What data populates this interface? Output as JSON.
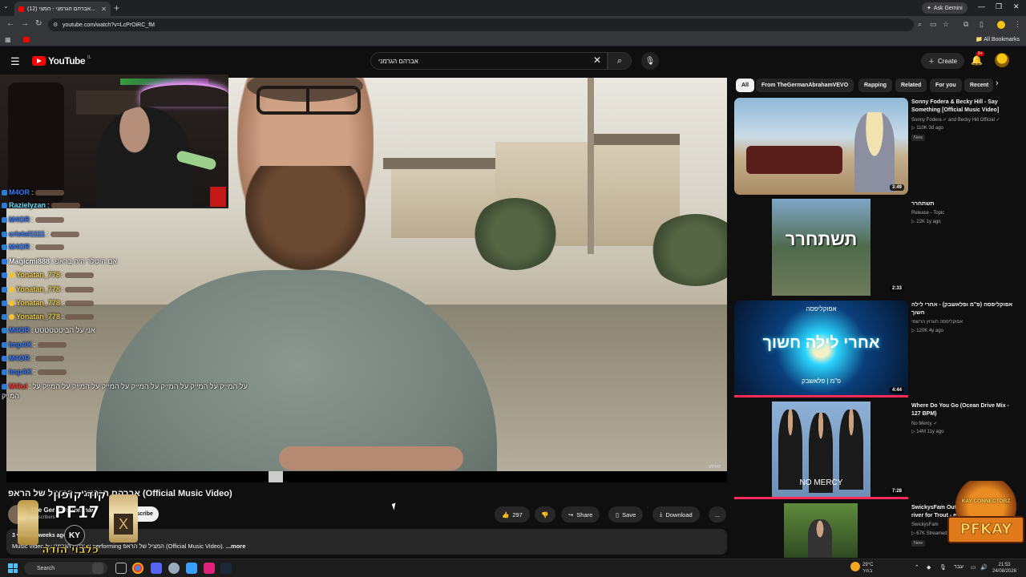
{
  "browser": {
    "tab_title": "(12) אברהם הגרמני - המצי...",
    "url": "youtube.com/watch?v=LcPrOiRC_fM",
    "ask_gemini": "Ask Gemini",
    "all_bookmarks": "All Bookmarks"
  },
  "header": {
    "logo_text": "YouTube",
    "country": "IL",
    "search_value": "אברהם הגרמני",
    "create_label": "Create",
    "notif_count": "9+"
  },
  "chat": [
    {
      "user": "M4OR",
      "msg": "",
      "color": "u-blue"
    },
    {
      "user": "Razielyzan",
      "msg": "",
      "color": "u-cyan"
    },
    {
      "user": "M4OR",
      "msg": "",
      "color": "u-blue"
    },
    {
      "user": "cristal1111",
      "msg": "",
      "color": "u-blue"
    },
    {
      "user": "M4OR",
      "msg": "",
      "color": "u-blue"
    },
    {
      "user": "Magicmi888",
      "msg": "אם היטלר היה בראפ",
      "color": "u-white"
    },
    {
      "user": "Yonatan_778",
      "msg": "",
      "color": "u-yellow"
    },
    {
      "user": "Yonatan_778",
      "msg": "",
      "color": "u-yellow"
    },
    {
      "user": "Yonatan_778",
      "msg": "",
      "color": "u-yellow"
    },
    {
      "user": "Yonatan_778",
      "msg": "",
      "color": "u-yellow"
    },
    {
      "user": "M4OR",
      "msg": "אני על הביטטטטטט",
      "color": "u-blue"
    },
    {
      "user": "ImpAK",
      "msg": "",
      "color": "u-blue"
    },
    {
      "user": "M4OR",
      "msg": "",
      "color": "u-blue"
    },
    {
      "user": "ImpAK",
      "msg": "",
      "color": "u-blue"
    },
    {
      "user": "M4lul",
      "msg": "על המייק על המייק על המייק על המייק על המייק על המייק על המייק על",
      "color": "u-red"
    }
  ],
  "chat_wrap": "המייק",
  "video": {
    "title": "אברהם הגרמני - המציל של הראפ (Official Music Video)",
    "channel": "The German Abraham",
    "subs": "subscribers",
    "subscribe": "Subscribe",
    "likes": "297",
    "share": "Share",
    "save": "Save",
    "download": "Download",
    "more": "...",
    "views_meta": "3 views  3 weeks ago",
    "description": "Music video by אברהם הגרמני performing המציל של הראפ (Official Music Video).",
    "desc_more": "...more",
    "watermark": "vevo"
  },
  "promo": {
    "line1": "קוד קופון",
    "line2": "PF17",
    "line3": "כלבוי הודה",
    "ky": "KY",
    "bottle_letter": "X"
  },
  "chips": [
    "All",
    "From TheGermanAbrahamVEVO",
    "Rapping",
    "Related",
    "For you",
    "Recent"
  ],
  "recs": [
    {
      "title": "Sonny Fodera & Becky Hill - Say Something [Official Music Video]",
      "channel": "Sonny Fodera ✓ and Becky Hill Official ✓",
      "meta": "▷ 110K  3d ago",
      "badge": "New",
      "duration": "3:49"
    },
    {
      "title": "תשתחרר",
      "channel": "Release - Topic",
      "meta": "▷ 22K  1y ago",
      "badge": "",
      "duration": "2:33"
    },
    {
      "title": "אפוקליפסה (פ\"מ ופלאשבק) - אחרי לילה חשוך",
      "channel": "אפוקליפסה הערוץ הרשמי",
      "meta": "▷ 120K  4y ago",
      "badge": "",
      "duration": "4:44"
    },
    {
      "title": "Where Do You Go (Ocean Drive Mix - 127 BPM)",
      "channel": "No Mercy ✓",
      "meta": "▷ 14M  11y ago",
      "badge": "",
      "duration": "7:28"
    },
    {
      "title": "SwickysFam Outdoors - Fishing the river for Trout - everyone you",
      "channel": "SwickysFam",
      "meta": "▷ 67K  Streamed",
      "badge": "New",
      "duration": ""
    }
  ],
  "thumb_texts": {
    "rec2_big": "תשתחרר",
    "rec3_top": "אפוקליפסה",
    "rec3_big": "אחרי לילה חשוך",
    "rec3_bottom": "פ\"מ | פלאשבק",
    "rec4_text": "NO MERCY"
  },
  "pfkay": {
    "top": "KAY CONNECTORZ",
    "name": "PFKAY"
  },
  "taskbar": {
    "search": "Search",
    "weather_temp": "29°C",
    "weather_desc": "בהיר",
    "lang": "עבר",
    "time": "21:53",
    "date": "24/08/2026"
  },
  "colors": {
    "accent": "#ff0000",
    "bg": "#0f0f0f",
    "chip_bg": "#272727"
  }
}
